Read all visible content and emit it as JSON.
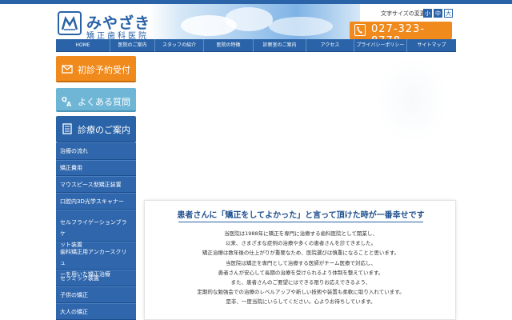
{
  "header": {
    "logo_main": "みやざき",
    "logo_sub": "矯正歯科医院",
    "font_size_label": "文字サイズの変更",
    "font_size_buttons": [
      "小",
      "中",
      "大"
    ],
    "phone": "027-323-8778"
  },
  "gnav": [
    "HOME",
    "医院のご案内",
    "スタッフの紹介",
    "医院の特徴",
    "診察室のご案内",
    "アクセス",
    "プライバシーポリシー",
    "サイトマップ"
  ],
  "sidebar": {
    "reserve_label": "初診予約受付",
    "faq_label": "よくある質問",
    "guide_label": "診療のご案内",
    "menu": [
      [
        "治療の流れ"
      ],
      [
        "矯正費用"
      ],
      [
        "マウスピース型矯正装置"
      ],
      [
        "口腔内3D光学スキャナー"
      ],
      [
        "セルフライゲーションブラケ",
        "ット装置"
      ],
      [
        "歯科矯正用アンカースクリュ",
        "ーを用いた矯正治療"
      ],
      [
        "セラミック装置"
      ],
      [
        "子供の矯正"
      ],
      [
        "大人の矯正"
      ]
    ]
  },
  "main": {
    "heading": "患者さんに「矯正をしてよかった」と言って頂けた時が一番幸せです",
    "intro": [
      "当医院は1988年に矯正を専門に治療する歯科医院として開業し、",
      "以来、さまざまな症例の治療や多くの患者さんを診てきました。",
      "矯正治療は数年後の仕上がりが重要なため、医院選びは慎重になることと思います。",
      "当医院は矯正を専門として治療する医師がチーム医療で対応し、",
      "患者さんが安心して長期の治療を受けられるよう体制を整えています。",
      "また、患者さんのご要望にはできる限りお応えできるよう、",
      "定期的な勉強会での治療のレベルアップや新しい技術や装置も柔軟に取り入れています。",
      "是非、一度当院にいらしてください。心よりお待ちしています。"
    ]
  },
  "colors": {
    "primary_blue": "#2a63a8",
    "orange": "#f08a1c",
    "light_blue": "#6fb6d6"
  }
}
